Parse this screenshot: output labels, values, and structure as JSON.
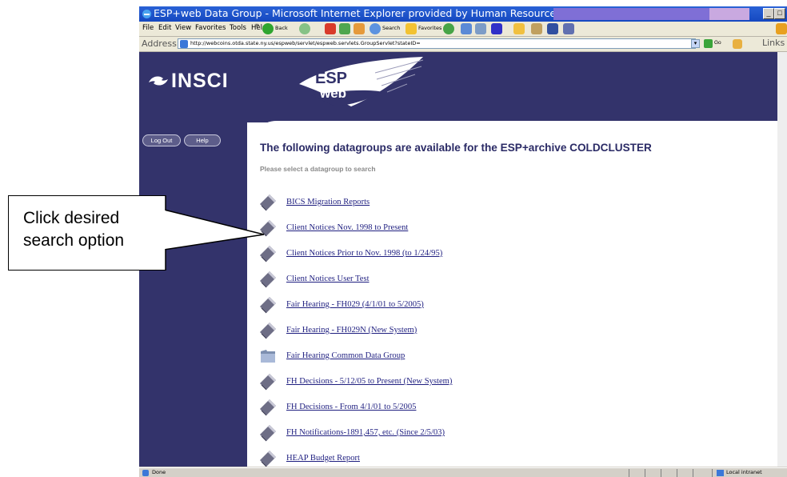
{
  "callout": {
    "line1": "Click desired",
    "line2": "search option"
  },
  "window": {
    "title": "ESP+web Data Group - Microsoft Internet Explorer provided by Human Resources Administration",
    "min_glyph": "_",
    "max_glyph": "□"
  },
  "menu": {
    "items": [
      "File",
      "Edit",
      "View",
      "Favorites",
      "Tools",
      "Help"
    ],
    "chevron": "»",
    "back_label": "Back",
    "search_label": "Search",
    "favorites_label": "Favorites"
  },
  "address": {
    "label": "Address",
    "url": "http://webcoins.otda.state.ny.us/espweb/servlet/espweb.servlets.GroupServlet?stateID=",
    "go_label": "Go",
    "links_label": "Links"
  },
  "brand": {
    "insci": "INSCI",
    "esp": "ESP",
    "plus": "+",
    "web": "web"
  },
  "buttons": {
    "logout": "Log Out",
    "help": "Help"
  },
  "page": {
    "heading": "The following datagroups are available for the ESP+archive COLDCLUSTER",
    "subheading": "Please select a datagroup to search"
  },
  "datagroups": [
    {
      "label": "BICS Migration Reports",
      "icon": "book-icon"
    },
    {
      "label": "Client Notices Nov. 1998 to Present",
      "icon": "book-icon"
    },
    {
      "label": "Client Notices Prior to Nov. 1998 (to 1/24/95)",
      "icon": "book-icon"
    },
    {
      "label": "Client Notices User Test",
      "icon": "book-icon"
    },
    {
      "label": "Fair Hearing - FH029 (4/1/01 to 5/2005)",
      "icon": "book-icon"
    },
    {
      "label": "Fair Hearing - FH029N (New System)",
      "icon": "book-icon"
    },
    {
      "label": "Fair Hearing Common Data Group",
      "icon": "folder-icon"
    },
    {
      "label": "FH Decisions - 5/12/05 to Present (New System)",
      "icon": "book-icon"
    },
    {
      "label": "FH Decisions - From 4/1/01 to 5/2005",
      "icon": "book-icon"
    },
    {
      "label": "FH Notifications-1891,457, etc. (Since 2/5/03)",
      "icon": "book-icon"
    },
    {
      "label": "HEAP Budget Report",
      "icon": "book-icon"
    }
  ],
  "status": {
    "text": "Done",
    "zone": "Local intranet"
  },
  "colors": {
    "header_navy": "#33336b",
    "link": "#1f1f80",
    "titlebar": "#1f55cc"
  }
}
